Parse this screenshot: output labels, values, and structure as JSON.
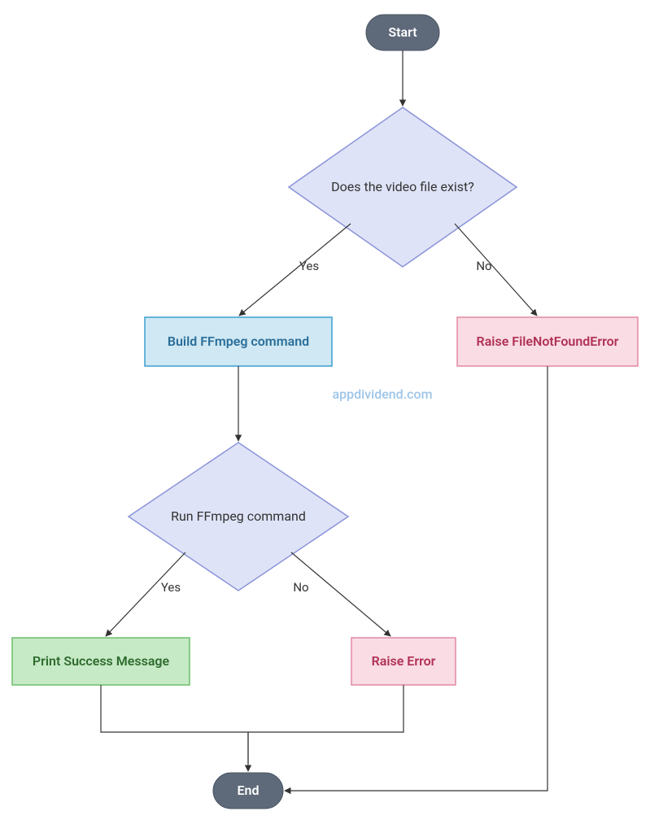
{
  "nodes": {
    "start": "Start",
    "decision1": "Does the video file exist?",
    "build": "Build FFmpeg command",
    "fileNotFound": "Raise FileNotFoundError",
    "decision2": "Run FFmpeg command",
    "success": "Print Success Message",
    "raiseError": "Raise Error",
    "end": "End"
  },
  "edges": {
    "yes1": "Yes",
    "no1": "No",
    "yes2": "Yes",
    "no2": "No"
  },
  "watermark": "appdividend.com",
  "colors": {
    "terminal": "#5e6a7a",
    "decision": "#dfe3f7",
    "processBlue": "#cfe8f3",
    "processGreen": "#c6e9c6",
    "processPink": "#f9dce4",
    "buildText": "#2a6e99",
    "errorText": "#b03056",
    "successText": "#2e6b2e"
  }
}
